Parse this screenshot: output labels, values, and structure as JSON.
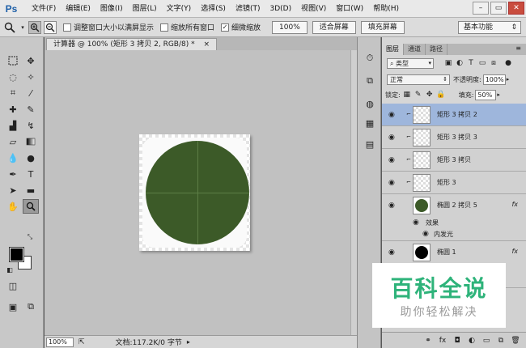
{
  "app": {
    "logo": "Ps",
    "menu": [
      "文件(F)",
      "编辑(E)",
      "图像(I)",
      "图层(L)",
      "文字(Y)",
      "选择(S)",
      "滤镜(T)",
      "3D(D)",
      "视图(V)",
      "窗口(W)",
      "帮助(H)"
    ],
    "window_controls": [
      "–",
      "▭",
      "✕"
    ]
  },
  "options": {
    "tool_icon": "zoom-icon",
    "checkbox_resize": "调整窗口大小以满屏显示",
    "checkbox_all_windows": "缩放所有窗口",
    "checkbox_scrubby": "细微缩放",
    "btn_100": "100%",
    "btn_fit": "适合屏幕",
    "btn_fill": "填充屏幕",
    "workspace": "基本功能"
  },
  "document": {
    "tab_title": "计算器 @ 100% (矩形 3 拷贝 2, RGB/8) *",
    "zoom": "100%",
    "status": "文档:117.2K/0 字节",
    "accent_color": "#3c5a28"
  },
  "layers_panel": {
    "tabs": [
      "图层",
      "通道",
      "路径"
    ],
    "filter_label": "类型",
    "blend_mode": "正常",
    "opacity_label": "不透明度:",
    "opacity_value": "100%",
    "lock_label": "锁定:",
    "fill_label": "填充:",
    "fill_value": "50%",
    "layers": [
      {
        "name": "矩形 3 拷贝 2",
        "selected": true
      },
      {
        "name": "矩形 3 拷贝 3",
        "selected": false
      },
      {
        "name": "矩形 3 拷贝",
        "selected": false
      },
      {
        "name": "矩形 3",
        "selected": false
      },
      {
        "name": "椭圆 2 拷贝 5",
        "selected": false,
        "fx": "fx"
      },
      {
        "name": "椭圆 1",
        "selected": false,
        "fx": "fx"
      }
    ],
    "effects_label": "效果",
    "inner_glow_label": "内发光"
  },
  "watermark": {
    "title": "百科全说",
    "subtitle": "助你轻松解决"
  }
}
